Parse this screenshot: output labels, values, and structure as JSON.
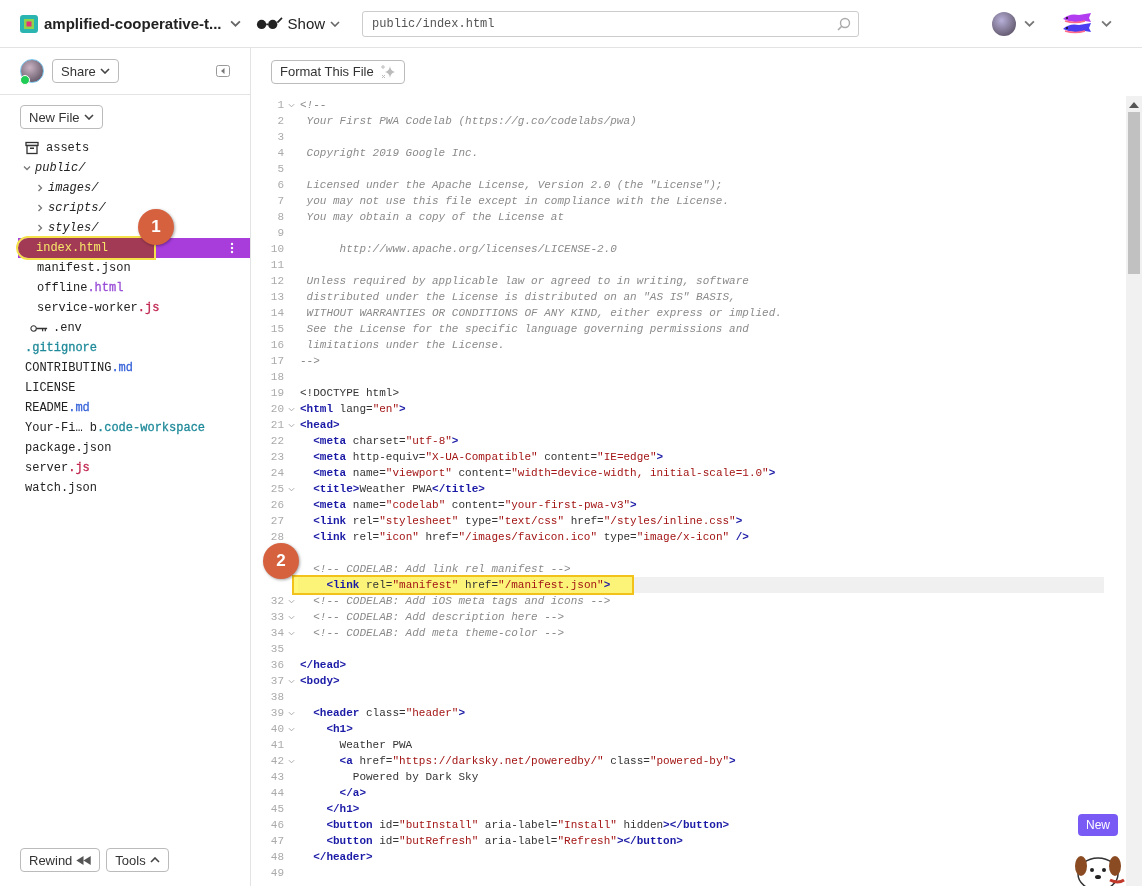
{
  "topbar": {
    "project": "amplified-cooperative-t...",
    "show_label": "Show",
    "search": {
      "value": "public/index.html"
    }
  },
  "sidebar": {
    "share_label": "Share",
    "new_file_label": "New File",
    "rewind_label": "Rewind",
    "tools_label": "Tools",
    "tree": [
      {
        "kind": "assets",
        "name": [
          {
            "text": "assets"
          }
        ],
        "selected": false
      },
      {
        "kind": "folder",
        "name": [
          {
            "text": "public/"
          }
        ],
        "selected": false,
        "expanded": true,
        "children": [
          {
            "kind": "folder",
            "name": [
              {
                "text": "images/"
              }
            ],
            "selected": false,
            "expanded": false
          },
          {
            "kind": "folder",
            "name": [
              {
                "text": "scripts/"
              }
            ],
            "selected": false,
            "expanded": false
          },
          {
            "kind": "folder",
            "name": [
              {
                "text": "styles/"
              }
            ],
            "selected": false,
            "expanded": false
          },
          {
            "kind": "file",
            "name": [
              {
                "text": "index.html"
              }
            ],
            "selected": true,
            "callout": "1"
          },
          {
            "kind": "file",
            "name": [
              {
                "text": "manifest.json"
              }
            ],
            "selected": false
          },
          {
            "kind": "file",
            "name": [
              {
                "text": "offline"
              },
              {
                "text": ".html",
                "color": "#9a4fd6"
              }
            ],
            "selected": false
          },
          {
            "kind": "file",
            "name": [
              {
                "text": "service-worker"
              },
              {
                "text": ".js",
                "color": "#c0264f"
              }
            ],
            "selected": false
          }
        ]
      },
      {
        "kind": "env",
        "name": [
          {
            "text": ".env"
          }
        ],
        "selected": false
      },
      {
        "kind": "file",
        "name": [
          {
            "text": ".gitignore",
            "color": "#1f8a9a"
          }
        ],
        "selected": false
      },
      {
        "kind": "file",
        "name": [
          {
            "text": "CONTRIBUTING"
          },
          {
            "text": ".md",
            "color": "#3b66d9"
          }
        ],
        "selected": false
      },
      {
        "kind": "file",
        "name": [
          {
            "text": "LICENSE"
          }
        ],
        "selected": false
      },
      {
        "kind": "file",
        "name": [
          {
            "text": "README"
          },
          {
            "text": ".md",
            "color": "#3b66d9"
          }
        ],
        "selected": false
      },
      {
        "kind": "file",
        "name": [
          {
            "text": "Your-Fi… b"
          },
          {
            "text": ".code-workspace",
            "color": "#1f8a9a"
          }
        ],
        "selected": false
      },
      {
        "kind": "file",
        "name": [
          {
            "text": "package.json"
          }
        ],
        "selected": false
      },
      {
        "kind": "file",
        "name": [
          {
            "text": "server"
          },
          {
            "text": ".js",
            "color": "#c0264f"
          }
        ],
        "selected": false
      },
      {
        "kind": "file",
        "name": [
          {
            "text": "watch.json"
          }
        ],
        "selected": false
      }
    ]
  },
  "editor": {
    "format_label": "Format This File",
    "lines": [
      {
        "number": "1",
        "foldable": true,
        "selected": false,
        "segments": [
          {
            "kind": "comment",
            "text": "<!--"
          }
        ]
      },
      {
        "number": "2",
        "foldable": false,
        "selected": false,
        "segments": [
          {
            "kind": "comment",
            "text": " Your First PWA Codelab (https://g.co/codelabs/pwa)"
          }
        ]
      },
      {
        "number": "3",
        "foldable": false,
        "selected": false
      },
      {
        "number": "4",
        "foldable": false,
        "selected": false,
        "segments": [
          {
            "kind": "comment",
            "text": " Copyright 2019 Google Inc."
          }
        ]
      },
      {
        "number": "5",
        "foldable": false,
        "selected": false
      },
      {
        "number": "6",
        "foldable": false,
        "selected": false,
        "segments": [
          {
            "kind": "comment",
            "text": " Licensed under the Apache License, Version 2.0 (the \"License\");"
          }
        ]
      },
      {
        "number": "7",
        "foldable": false,
        "selected": false,
        "segments": [
          {
            "kind": "comment",
            "text": " you may not use this file except in compliance with the License."
          }
        ]
      },
      {
        "number": "8",
        "foldable": false,
        "selected": false,
        "segments": [
          {
            "kind": "comment",
            "text": " You may obtain a copy of the License at"
          }
        ]
      },
      {
        "number": "9",
        "foldable": false,
        "selected": false
      },
      {
        "number": "10",
        "foldable": false,
        "selected": false,
        "segments": [
          {
            "kind": "comment",
            "text": "      http://www.apache.org/licenses/LICENSE-2.0"
          }
        ]
      },
      {
        "number": "11",
        "foldable": false,
        "selected": false
      },
      {
        "number": "12",
        "foldable": false,
        "selected": false,
        "segments": [
          {
            "kind": "comment",
            "text": " Unless required by applicable law or agreed to in writing, software"
          }
        ]
      },
      {
        "number": "13",
        "foldable": false,
        "selected": false,
        "segments": [
          {
            "kind": "comment",
            "text": " distributed under the License is distributed on an \"AS IS\" BASIS,"
          }
        ]
      },
      {
        "number": "14",
        "foldable": false,
        "selected": false,
        "segments": [
          {
            "kind": "comment",
            "text": " WITHOUT WARRANTIES OR CONDITIONS OF ANY KIND, either express or implied."
          }
        ]
      },
      {
        "number": "15",
        "foldable": false,
        "selected": false,
        "segments": [
          {
            "kind": "comment",
            "text": " See the License for the specific language governing permissions and"
          }
        ]
      },
      {
        "number": "16",
        "foldable": false,
        "selected": false,
        "segments": [
          {
            "kind": "comment",
            "text": " limitations under the License."
          }
        ]
      },
      {
        "number": "17",
        "foldable": false,
        "selected": false,
        "segments": [
          {
            "kind": "comment",
            "text": "-->"
          }
        ]
      },
      {
        "number": "18",
        "foldable": false,
        "selected": false
      },
      {
        "number": "19",
        "foldable": false,
        "selected": false,
        "segments": [
          {
            "kind": "text",
            "text": "<!DOCTYPE html>"
          }
        ]
      },
      {
        "number": "20",
        "foldable": true,
        "selected": false,
        "segments": [
          {
            "kind": "tag",
            "text": "<html"
          },
          {
            "kind": "attr",
            "text": " lang="
          },
          {
            "kind": "string",
            "text": "\"en\""
          },
          {
            "kind": "tag",
            "text": ">"
          }
        ]
      },
      {
        "number": "21",
        "foldable": true,
        "selected": false,
        "segments": [
          {
            "kind": "tag",
            "text": "<head>"
          }
        ]
      },
      {
        "number": "22",
        "foldable": false,
        "selected": false,
        "segments": [
          {
            "kind": "tag",
            "text": "  <meta"
          },
          {
            "kind": "attr",
            "text": " charset="
          },
          {
            "kind": "string",
            "text": "\"utf-8\""
          },
          {
            "kind": "tag",
            "text": ">"
          }
        ]
      },
      {
        "number": "23",
        "foldable": false,
        "selected": false,
        "segments": [
          {
            "kind": "tag",
            "text": "  <meta"
          },
          {
            "kind": "attr",
            "text": " http-equiv="
          },
          {
            "kind": "string",
            "text": "\"X-UA-Compatible\""
          },
          {
            "kind": "attr",
            "text": " content="
          },
          {
            "kind": "string",
            "text": "\"IE=edge\""
          },
          {
            "kind": "tag",
            "text": ">"
          }
        ]
      },
      {
        "number": "24",
        "foldable": false,
        "selected": false,
        "segments": [
          {
            "kind": "tag",
            "text": "  <meta"
          },
          {
            "kind": "attr",
            "text": " name="
          },
          {
            "kind": "string",
            "text": "\"viewport\""
          },
          {
            "kind": "attr",
            "text": " content="
          },
          {
            "kind": "string",
            "text": "\"width=device-width, initial-scale=1.0\""
          },
          {
            "kind": "tag",
            "text": ">"
          }
        ]
      },
      {
        "number": "25",
        "foldable": true,
        "selected": false,
        "segments": [
          {
            "kind": "tag",
            "text": "  <title>"
          },
          {
            "kind": "text",
            "text": "Weather PWA"
          },
          {
            "kind": "tag",
            "text": "</title>"
          }
        ]
      },
      {
        "number": "26",
        "foldable": false,
        "selected": false,
        "segments": [
          {
            "kind": "tag",
            "text": "  <meta"
          },
          {
            "kind": "attr",
            "text": " name="
          },
          {
            "kind": "string",
            "text": "\"codelab\""
          },
          {
            "kind": "attr",
            "text": " content="
          },
          {
            "kind": "string",
            "text": "\"your-first-pwa-v3\""
          },
          {
            "kind": "tag",
            "text": ">"
          }
        ]
      },
      {
        "number": "27",
        "foldable": false,
        "selected": false,
        "segments": [
          {
            "kind": "tag",
            "text": "  <link"
          },
          {
            "kind": "attr",
            "text": " rel="
          },
          {
            "kind": "string",
            "text": "\"stylesheet\""
          },
          {
            "kind": "attr",
            "text": " type="
          },
          {
            "kind": "string",
            "text": "\"text/css\""
          },
          {
            "kind": "attr",
            "text": " href="
          },
          {
            "kind": "string",
            "text": "\"/styles/inline.css\""
          },
          {
            "kind": "tag",
            "text": ">"
          }
        ]
      },
      {
        "number": "28",
        "foldable": false,
        "selected": false,
        "segments": [
          {
            "kind": "tag",
            "text": "  <link"
          },
          {
            "kind": "attr",
            "text": " rel="
          },
          {
            "kind": "string",
            "text": "\"icon\""
          },
          {
            "kind": "attr",
            "text": " href="
          },
          {
            "kind": "string",
            "text": "\"/images/favicon.ico\""
          },
          {
            "kind": "attr",
            "text": " type="
          },
          {
            "kind": "string",
            "text": "\"image/x-icon\""
          },
          {
            "kind": "tag",
            "text": " />"
          }
        ]
      },
      {
        "foldable": false,
        "selected": false
      },
      {
        "foldable": false,
        "selected": false,
        "segments": [
          {
            "kind": "comment",
            "text": "  <!-- CODELAB: Add link rel manifest -->"
          }
        ]
      },
      {
        "foldable": false,
        "selected": true,
        "callout": "2",
        "segments": [
          {
            "kind": "tag",
            "text": "    <link"
          },
          {
            "kind": "attr",
            "text": " rel="
          },
          {
            "kind": "string",
            "text": "\"manifest\""
          },
          {
            "kind": "attr",
            "text": " href="
          },
          {
            "kind": "string",
            "text": "\"/manifest.json\""
          },
          {
            "kind": "tag",
            "text": ">"
          }
        ]
      },
      {
        "number": "32",
        "foldable": true,
        "selected": false,
        "segments": [
          {
            "kind": "comment",
            "text": "  <!-- CODELAB: Add iOS meta tags and icons -->"
          }
        ]
      },
      {
        "number": "33",
        "foldable": true,
        "selected": false,
        "segments": [
          {
            "kind": "comment",
            "text": "  <!-- CODELAB: Add description here -->"
          }
        ]
      },
      {
        "number": "34",
        "foldable": true,
        "selected": false,
        "segments": [
          {
            "kind": "comment",
            "text": "  <!-- CODELAB: Add meta theme-color -->"
          }
        ]
      },
      {
        "number": "35",
        "foldable": false,
        "selected": false
      },
      {
        "number": "36",
        "foldable": false,
        "selected": false,
        "segments": [
          {
            "kind": "tag",
            "text": "</head>"
          }
        ]
      },
      {
        "number": "37",
        "foldable": true,
        "selected": false,
        "segments": [
          {
            "kind": "tag",
            "text": "<body>"
          }
        ]
      },
      {
        "number": "38",
        "foldable": false,
        "selected": false
      },
      {
        "number": "39",
        "foldable": true,
        "selected": false,
        "segments": [
          {
            "kind": "tag",
            "text": "  <header"
          },
          {
            "kind": "attr",
            "text": " class="
          },
          {
            "kind": "string",
            "text": "\"header\""
          },
          {
            "kind": "tag",
            "text": ">"
          }
        ]
      },
      {
        "number": "40",
        "foldable": true,
        "selected": false,
        "segments": [
          {
            "kind": "tag",
            "text": "    <h1>"
          }
        ]
      },
      {
        "number": "41",
        "foldable": false,
        "selected": false,
        "segments": [
          {
            "kind": "text",
            "text": "      Weather PWA"
          }
        ]
      },
      {
        "number": "42",
        "foldable": true,
        "selected": false,
        "segments": [
          {
            "kind": "tag",
            "text": "      <a"
          },
          {
            "kind": "attr",
            "text": " href="
          },
          {
            "kind": "string",
            "text": "\"https://darksky.net/poweredby/\""
          },
          {
            "kind": "attr",
            "text": " class="
          },
          {
            "kind": "string",
            "text": "\"powered-by\""
          },
          {
            "kind": "tag",
            "text": ">"
          }
        ]
      },
      {
        "number": "43",
        "foldable": false,
        "selected": false,
        "segments": [
          {
            "kind": "text",
            "text": "        Powered by Dark Sky"
          }
        ]
      },
      {
        "number": "44",
        "foldable": false,
        "selected": false,
        "segments": [
          {
            "kind": "tag",
            "text": "      </a>"
          }
        ]
      },
      {
        "number": "45",
        "foldable": false,
        "selected": false,
        "segments": [
          {
            "kind": "tag",
            "text": "    </h1>"
          }
        ]
      },
      {
        "number": "46",
        "foldable": false,
        "selected": false,
        "segments": [
          {
            "kind": "tag",
            "text": "    <button"
          },
          {
            "kind": "attr",
            "text": " id="
          },
          {
            "kind": "string",
            "text": "\"butInstall\""
          },
          {
            "kind": "attr",
            "text": " aria-label="
          },
          {
            "kind": "string",
            "text": "\"Install\""
          },
          {
            "kind": "attr",
            "text": " hidden"
          },
          {
            "kind": "tag",
            "text": "></button>"
          }
        ]
      },
      {
        "number": "47",
        "foldable": false,
        "selected": false,
        "segments": [
          {
            "kind": "tag",
            "text": "    <button"
          },
          {
            "kind": "attr",
            "text": " id="
          },
          {
            "kind": "string",
            "text": "\"butRefresh\""
          },
          {
            "kind": "attr",
            "text": " aria-label="
          },
          {
            "kind": "string",
            "text": "\"Refresh\""
          },
          {
            "kind": "tag",
            "text": "></button>"
          }
        ]
      },
      {
        "number": "48",
        "foldable": false,
        "selected": false,
        "segments": [
          {
            "kind": "tag",
            "text": "  </header>"
          }
        ]
      },
      {
        "number": "49",
        "foldable": false,
        "selected": false
      }
    ]
  },
  "mascot": {
    "badge": "New"
  }
}
